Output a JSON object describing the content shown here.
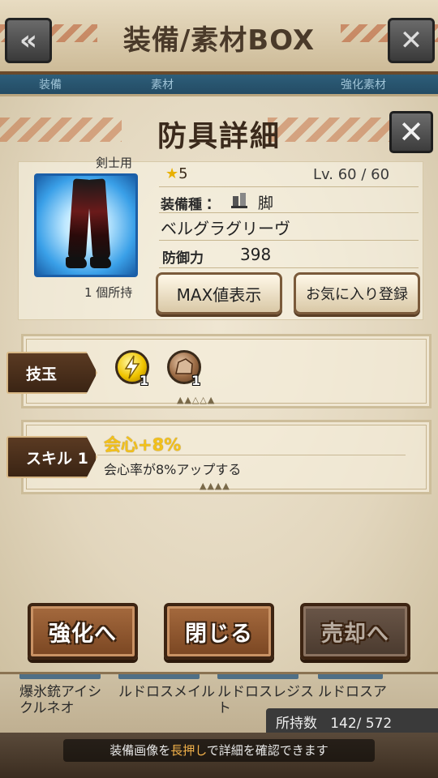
{
  "background": {
    "header_title": "装備/素材BOX",
    "tabs": [
      "装備",
      "素材",
      "",
      "強化素材"
    ],
    "list_items": [
      {
        "line1": "爆氷銃アイシ",
        "line2": "クルネオ"
      },
      {
        "line1": "ルドロスメイル",
        "line2": ""
      },
      {
        "line1": "ルドロスレジス",
        "line2": "ト"
      },
      {
        "line1": "ルドロスア",
        "line2": ""
      }
    ],
    "owned_count_label": "所持数",
    "owned_count": "142/ 572",
    "hint_prefix": "装備画像を",
    "hint_highlight": "長押し",
    "hint_suffix": "で詳細を確認できます"
  },
  "modal": {
    "title": "防具詳細",
    "item": {
      "class": "剣士用",
      "owned": "1 個所持",
      "rarity": "5",
      "level": "Lv. 60 / 60",
      "equip_type_label": "装備種",
      "equip_type_value": "脚",
      "name": "ベルグラグリーヴ",
      "defense_label": "防御力",
      "defense_value": "398"
    },
    "buttons": {
      "max": "MAX値表示",
      "favorite": "お気に入り登録"
    },
    "slots": {
      "label": "技玉",
      "gems": [
        {
          "icon": "lightning-gem-icon",
          "count": "1"
        },
        {
          "icon": "rock-gem-icon",
          "count": "1"
        }
      ]
    },
    "skill": {
      "label": "スキル 1",
      "name": "会心+8%",
      "description": "会心率が8%アップする"
    },
    "actions": {
      "enhance": "強化へ",
      "close": "閉じる",
      "sell": "売却へ"
    }
  },
  "colors": {
    "skill_name": "#f3c11a",
    "rarity_star": "#e8b000",
    "hint_highlight": "#f0b04a"
  }
}
